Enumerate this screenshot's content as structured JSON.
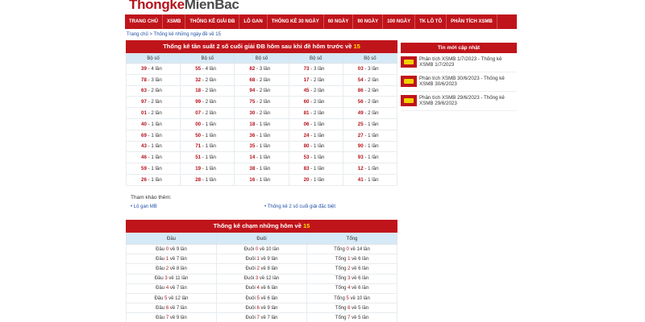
{
  "logo": {
    "part1": "Thongke",
    "part2": "MienBac"
  },
  "nav": [
    "TRANG CHỦ",
    "XSMB",
    "THỐNG KÊ GIẢI ĐB",
    "LÔ GAN",
    "THỐNG KÊ 30 NGÀY",
    "60 NGÀY",
    "90 NGÀY",
    "100 NGÀY",
    "TK LÔ TÔ",
    "PHÂN TÍCH XSMB"
  ],
  "breadcrumb": {
    "home": "Trang chủ",
    "sep": " > ",
    "current": "Thống kê những ngày đề về 15"
  },
  "freq": {
    "title": "Thống kê tần suất 2 số cuối giải ĐB hôm sau khi đề hôm trước về",
    "highlight": "15",
    "header": [
      "Bộ số",
      "Bộ số",
      "Bộ số",
      "Bộ số",
      "Bộ số"
    ],
    "rows": [
      [
        [
          "39",
          " - 4 lần"
        ],
        [
          "55",
          " - 4 lần"
        ],
        [
          "82",
          " - 3 lần"
        ],
        [
          "73",
          " - 3 lần"
        ],
        [
          "03",
          " - 3 lần"
        ]
      ],
      [
        [
          "78",
          " - 3 lần"
        ],
        [
          "32",
          " - 2 lần"
        ],
        [
          "68",
          " - 2 lần"
        ],
        [
          "17",
          " - 2 lần"
        ],
        [
          "54",
          " - 2 lần"
        ]
      ],
      [
        [
          "63",
          " - 2 lần"
        ],
        [
          "18",
          " - 2 lần"
        ],
        [
          "94",
          " - 2 lần"
        ],
        [
          "45",
          " - 2 lần"
        ],
        [
          "86",
          " - 2 lần"
        ]
      ],
      [
        [
          "97",
          " - 2 lần"
        ],
        [
          "99",
          " - 2 lần"
        ],
        [
          "75",
          " - 2 lần"
        ],
        [
          "60",
          " - 2 lần"
        ],
        [
          "56",
          " - 2 lần"
        ]
      ],
      [
        [
          "01",
          " - 2 lần"
        ],
        [
          "07",
          " - 2 lần"
        ],
        [
          "30",
          " - 2 lần"
        ],
        [
          "81",
          " - 2 lần"
        ],
        [
          "49",
          " - 2 lần"
        ]
      ],
      [
        [
          "40",
          " - 1 lần"
        ],
        [
          "00",
          " - 1 lần"
        ],
        [
          "18",
          " - 1 lần"
        ],
        [
          "06",
          " - 1 lần"
        ],
        [
          "25",
          " - 1 lần"
        ]
      ],
      [
        [
          "69",
          " - 1 lần"
        ],
        [
          "50",
          " - 1 lần"
        ],
        [
          "36",
          " - 1 lần"
        ],
        [
          "24",
          " - 1 lần"
        ],
        [
          "27",
          " - 1 lần"
        ]
      ],
      [
        [
          "43",
          " - 1 lần"
        ],
        [
          "71",
          " - 1 lần"
        ],
        [
          "35",
          " - 1 lần"
        ],
        [
          "80",
          " - 1 lần"
        ],
        [
          "90",
          " - 1 lần"
        ]
      ],
      [
        [
          "46",
          " - 1 lần"
        ],
        [
          "51",
          " - 1 lần"
        ],
        [
          "14",
          " - 1 lần"
        ],
        [
          "53",
          " - 1 lần"
        ],
        [
          "93",
          " - 1 lần"
        ]
      ],
      [
        [
          "59",
          " - 1 lần"
        ],
        [
          "19",
          " - 1 lần"
        ],
        [
          "38",
          " - 1 lần"
        ],
        [
          "83",
          " - 1 lần"
        ],
        [
          "12",
          " - 1 lần"
        ]
      ],
      [
        [
          "26",
          " - 1 lần"
        ],
        [
          "28",
          " - 1 lần"
        ],
        [
          "16",
          " - 1 lần"
        ],
        [
          "20",
          " - 1 lần"
        ],
        [
          "41",
          " - 1 lần"
        ]
      ]
    ]
  },
  "ref": {
    "label": "Tham khảo thêm:",
    "links": [
      "Lô gan MB",
      "Thống kê 2 số cuối giải đặc biệt"
    ]
  },
  "touch": {
    "title": "Thống kê chạm những hôm về",
    "highlight": "15",
    "header": [
      "Đầu",
      "Đuôi",
      "Tổng"
    ],
    "rows": [
      [
        [
          "Đầu ",
          "0",
          " về 9 lần"
        ],
        [
          "Đuôi ",
          "0",
          " về 10 lần"
        ],
        [
          "Tổng ",
          "0",
          " về 14 lần"
        ]
      ],
      [
        [
          "Đầu ",
          "1",
          " về 7 lần"
        ],
        [
          "Đuôi ",
          "1",
          " về 9 lần"
        ],
        [
          "Tổng ",
          "1",
          " về 6 lần"
        ]
      ],
      [
        [
          "Đầu ",
          "2",
          " về 8 lần"
        ],
        [
          "Đuôi ",
          "2",
          " về 8 lần"
        ],
        [
          "Tổng ",
          "2",
          " về 6 lần"
        ]
      ],
      [
        [
          "Đầu ",
          "3",
          " về 11 lần"
        ],
        [
          "Đuôi ",
          "3",
          " về 12 lần"
        ],
        [
          "Tổng ",
          "3",
          " về 6 lần"
        ]
      ],
      [
        [
          "Đầu ",
          "4",
          " về 7 lần"
        ],
        [
          "Đuôi ",
          "4",
          " về 6 lần"
        ],
        [
          "Tổng ",
          "4",
          " về 6 lần"
        ]
      ],
      [
        [
          "Đầu ",
          "5",
          " về 12 lần"
        ],
        [
          "Đuôi ",
          "5",
          " về 6 lần"
        ],
        [
          "Tổng ",
          "5",
          " về 10 lần"
        ]
      ],
      [
        [
          "Đầu ",
          "6",
          " về 7 lần"
        ],
        [
          "Đuôi ",
          "6",
          " về 9 lần"
        ],
        [
          "Tổng ",
          "6",
          " về 5 lần"
        ]
      ],
      [
        [
          "Đầu ",
          "7",
          " về 9 lần"
        ],
        [
          "Đuôi ",
          "7",
          " về 7 lần"
        ],
        [
          "Tổng ",
          "7",
          " về 5 lần"
        ]
      ]
    ]
  },
  "side": {
    "title": "Tin mới cập nhật",
    "items": [
      "Phân tích XSMB 1/7/2023 - Thống kê XSMB 1/7/2023",
      "Phân tích XSMB 30/6/2023 - Thống kê XSMB 30/6/2023",
      "Phân tích XSMB 29/6/2023 - Thống kê XSMB 29/6/2023"
    ]
  }
}
